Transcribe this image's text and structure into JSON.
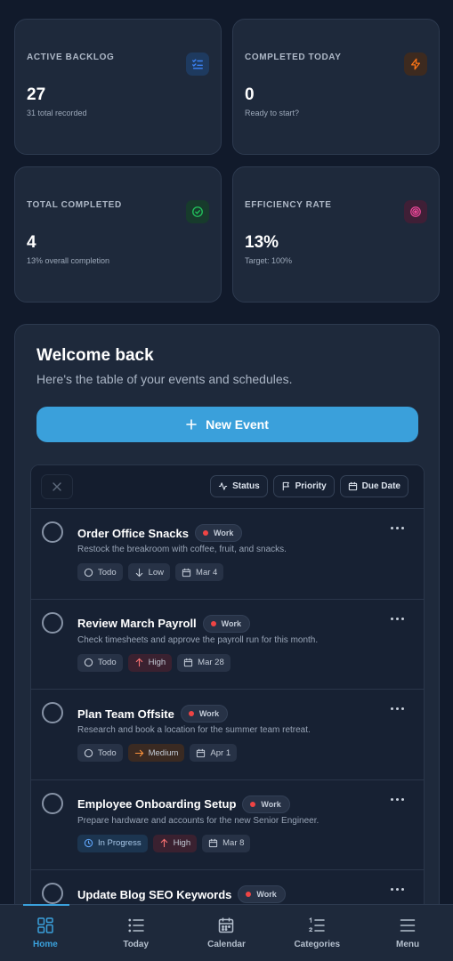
{
  "stats": [
    {
      "label": "ACTIVE BACKLOG",
      "value": "27",
      "sub": "31 total recorded",
      "icon": "list-check-icon",
      "color": "#3b82f6"
    },
    {
      "label": "COMPLETED TODAY",
      "value": "0",
      "sub": "Ready to start?",
      "icon": "bolt-icon",
      "color": "#f97316"
    },
    {
      "label": "TOTAL COMPLETED",
      "value": "4",
      "sub": "13% overall completion",
      "icon": "check-circle-icon",
      "color": "#22c55e"
    },
    {
      "label": "EFFICIENCY RATE",
      "value": "13%",
      "sub": "Target: 100%",
      "icon": "target-icon",
      "color": "#ec4899"
    }
  ],
  "welcome": {
    "title": "Welcome back",
    "subtitle": "Here's the table of your events and schedules.",
    "new_event_label": "New Event"
  },
  "filters": {
    "status": "Status",
    "priority": "Priority",
    "due_date": "Due Date"
  },
  "tasks": [
    {
      "title": "Order Office Snacks",
      "category": "Work",
      "description": "Restock the breakroom with coffee, fruit, and snacks.",
      "status": "Todo",
      "priority": "Low",
      "due": "Mar 4"
    },
    {
      "title": "Review March Payroll",
      "category": "Work",
      "description": "Check timesheets and approve the payroll run for this month.",
      "status": "Todo",
      "priority": "High",
      "due": "Mar 28"
    },
    {
      "title": "Plan Team Offsite",
      "category": "Work",
      "description": "Research and book a location for the summer team retreat.",
      "status": "Todo",
      "priority": "Medium",
      "due": "Apr 1"
    },
    {
      "title": "Employee Onboarding Setup",
      "category": "Work",
      "description": "Prepare hardware and accounts for the new Senior Engineer.",
      "status": "In Progress",
      "priority": "High",
      "due": "Mar 8"
    },
    {
      "title": "Update Blog SEO Keywords",
      "category": "Work",
      "description": "",
      "status": "",
      "priority": "",
      "due": ""
    }
  ],
  "nav": [
    {
      "label": "Home",
      "active": true
    },
    {
      "label": "Today",
      "active": false
    },
    {
      "label": "Calendar",
      "active": false
    },
    {
      "label": "Categories",
      "active": false
    },
    {
      "label": "Menu",
      "active": false
    }
  ],
  "colors": {
    "accent": "#3aa0db",
    "background": "#111a2b",
    "card": "#1e293b",
    "category_dot": "#ef4444",
    "priority_high": "#f87171",
    "priority_medium": "#fb923c"
  }
}
